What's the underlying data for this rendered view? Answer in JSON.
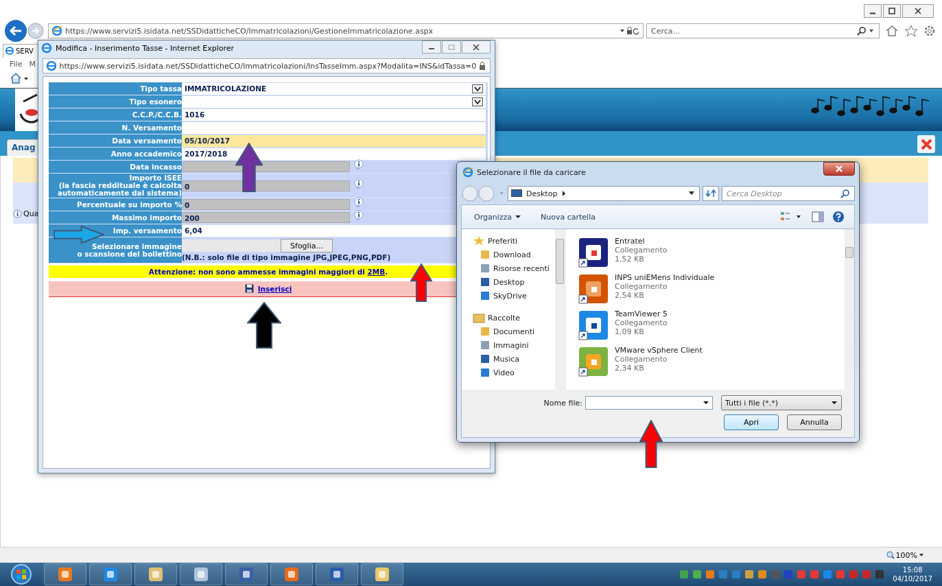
{
  "browser": {
    "tab": "SERV",
    "url": "https://www.servizi5.isidata.net/SSDidatticheCO/Immatricolazioni/GestioneImmatricolazione.aspx",
    "search_placeholder": "Cerca...",
    "menu": [
      "File",
      "M"
    ],
    "zoom": "100%"
  },
  "page": {
    "tab": "Anag",
    "info_text": "Qua"
  },
  "popup": {
    "title": "Modifica - Inserimento Tasse - Internet Explorer",
    "url": "https://www.servizi5.isidata.net/SSDidatticheCO/Immatricolazioni/InsTasseImm.aspx?Modalita=INS&idTassa=0",
    "fields": [
      {
        "label": "Tipo tassa",
        "kind": "select",
        "value": "IMMATRICOLAZIONE"
      },
      {
        "label": "Tipo esonero",
        "kind": "select"
      },
      {
        "label": "C.C.P./C.C.B.",
        "kind": "text",
        "value": "1016"
      },
      {
        "label": "N. Versamento",
        "kind": "text"
      },
      {
        "label": "Data versamento",
        "kind": "focus",
        "value": "05/10/2017"
      },
      {
        "label": "Anno accademico",
        "kind": "text",
        "value": "2017/2018"
      },
      {
        "label": "Data incasso",
        "kind": "readonly"
      },
      {
        "label": "Importo ISEE\n(la fascia reddituale è calcolta\nautomaticamente dal sistema)",
        "kind": "readonly",
        "value": "0"
      },
      {
        "label": "Percentuale su importo %",
        "kind": "readonly",
        "value": "0"
      },
      {
        "label": "Massimo importo",
        "kind": "readonly",
        "value": "200"
      },
      {
        "label": "Imp. versamento",
        "kind": "text",
        "value": "6,04"
      },
      {
        "label": "Selezionare immagine\no scansione del bollettino",
        "kind": "file",
        "button": "Sfoglia...",
        "note": "(N.B.: solo file di tipo immagine JPG,JPEG,PNG,PDF)"
      }
    ],
    "warning": {
      "text": "Attenzione: non sono ammesse immagini maggiori di",
      "link": "2MB",
      "end": "."
    },
    "submit": "Inserisci"
  },
  "dialog": {
    "title": "Selezionare il file da caricare",
    "location": "Desktop",
    "search_placeholder": "Cerca Desktop",
    "toolbar": [
      "Organizza",
      "Nuova cartella"
    ],
    "nav": [
      {
        "label": "Preferiti",
        "children": [
          {
            "label": "Download"
          },
          {
            "label": "Risorse recenti"
          },
          {
            "label": "Desktop"
          },
          {
            "label": "SkyDrive"
          }
        ]
      },
      {
        "label": "Raccolte",
        "children": [
          {
            "label": "Documenti"
          },
          {
            "label": "Immagini"
          },
          {
            "label": "Musica"
          },
          {
            "label": "Video"
          }
        ]
      }
    ],
    "files": [
      {
        "name": "Entratel",
        "type": "Collegamento",
        "size": "1,52 KB"
      },
      {
        "name": "INPS uniEMens Individuale",
        "type": "Collegamento",
        "size": "2,54 KB"
      },
      {
        "name": "TeamViewer 5",
        "type": "Collegamento",
        "size": "1,09 KB"
      },
      {
        "name": "VMware vSphere Client",
        "type": "Collegamento",
        "size": "2,34 KB"
      }
    ],
    "filename_label": "Nome file:",
    "filter": "Tutti i file (*.*)",
    "buttons": [
      "Apri",
      "Annulla"
    ]
  },
  "annotations": [
    {
      "kind": "up",
      "color": "#7030a0"
    },
    {
      "kind": "right",
      "color": "#1ca7e8"
    },
    {
      "kind": "up",
      "color": "#ff0000"
    },
    {
      "kind": "up",
      "color": "#000000"
    },
    {
      "kind": "up",
      "color": "#ff0000"
    }
  ],
  "taskbar": {
    "time": "15:08",
    "date": "04/10/2017"
  }
}
